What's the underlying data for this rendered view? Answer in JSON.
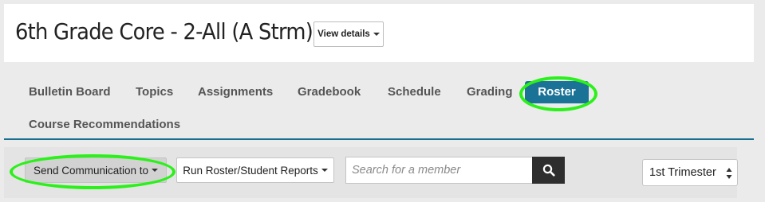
{
  "header": {
    "title": "6th Grade Core - 2-All (A Strm)",
    "view_details_label": "View details"
  },
  "nav": {
    "tabs": [
      {
        "label": "Bulletin Board"
      },
      {
        "label": "Topics"
      },
      {
        "label": "Assignments"
      },
      {
        "label": "Gradebook"
      },
      {
        "label": "Schedule"
      },
      {
        "label": "Grading"
      },
      {
        "label": "Roster",
        "active": true
      },
      {
        "label": "Course Recommendations"
      }
    ]
  },
  "toolbar": {
    "send_communication_label": "Send Communication to",
    "run_reports_label": "Run Roster/Student Reports",
    "search_placeholder": "Search for a member",
    "search_value": "",
    "term_selected": "1st Trimester"
  },
  "icons": {
    "search_button": "search-icon",
    "dropdown": "caret-down-icon",
    "select": "updown-arrows-icon"
  },
  "colors": {
    "active_tab": "#1a7296",
    "divider": "#1a6f8f",
    "highlight_ring": "#2bf01a",
    "search_button": "#2e2e2e"
  }
}
